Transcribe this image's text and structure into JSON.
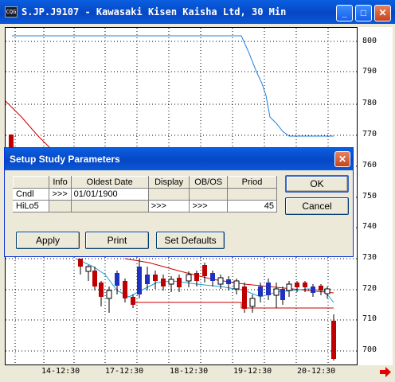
{
  "window": {
    "title": "S.JP.J9107 - Kawasaki Kisen Kaisha Ltd, 30 Min",
    "app_icon_text": "CQG",
    "buttons": {
      "minimize": "_",
      "maximize": "□",
      "close": "✕"
    }
  },
  "chart": {
    "y_ticks": [
      "800",
      "790",
      "780",
      "770",
      "760",
      "750",
      "740",
      "730",
      "720",
      "710",
      "700"
    ],
    "x_ticks": [
      "14-12:30",
      "17-12:30",
      "18-12:30",
      "19-12:30",
      "20-12:30"
    ],
    "colors": {
      "hilo": "#2080E0",
      "ma_red": "#CC0000",
      "ma_blue": "#1E9BD7",
      "up": "#2030C0",
      "down": "#C00000"
    }
  },
  "dialog": {
    "title": "Setup Study Parameters",
    "close": "✕",
    "columns": [
      "",
      "Info",
      "Oldest Date",
      "Display",
      "OB/OS",
      "Priod"
    ],
    "rows": [
      {
        "name": "Cndl",
        "info": ">>>",
        "oldest_date": "01/01/1900",
        "display": "",
        "obos": "",
        "priod": ""
      },
      {
        "name": "HiLo5",
        "info": "",
        "oldest_date": "",
        "display": ">>>",
        "obos": ">>>",
        "priod": "45"
      }
    ],
    "buttons": {
      "ok": "OK",
      "cancel": "Cancel",
      "apply": "Apply",
      "print": "Print",
      "set_defaults": "Set Defaults"
    }
  }
}
